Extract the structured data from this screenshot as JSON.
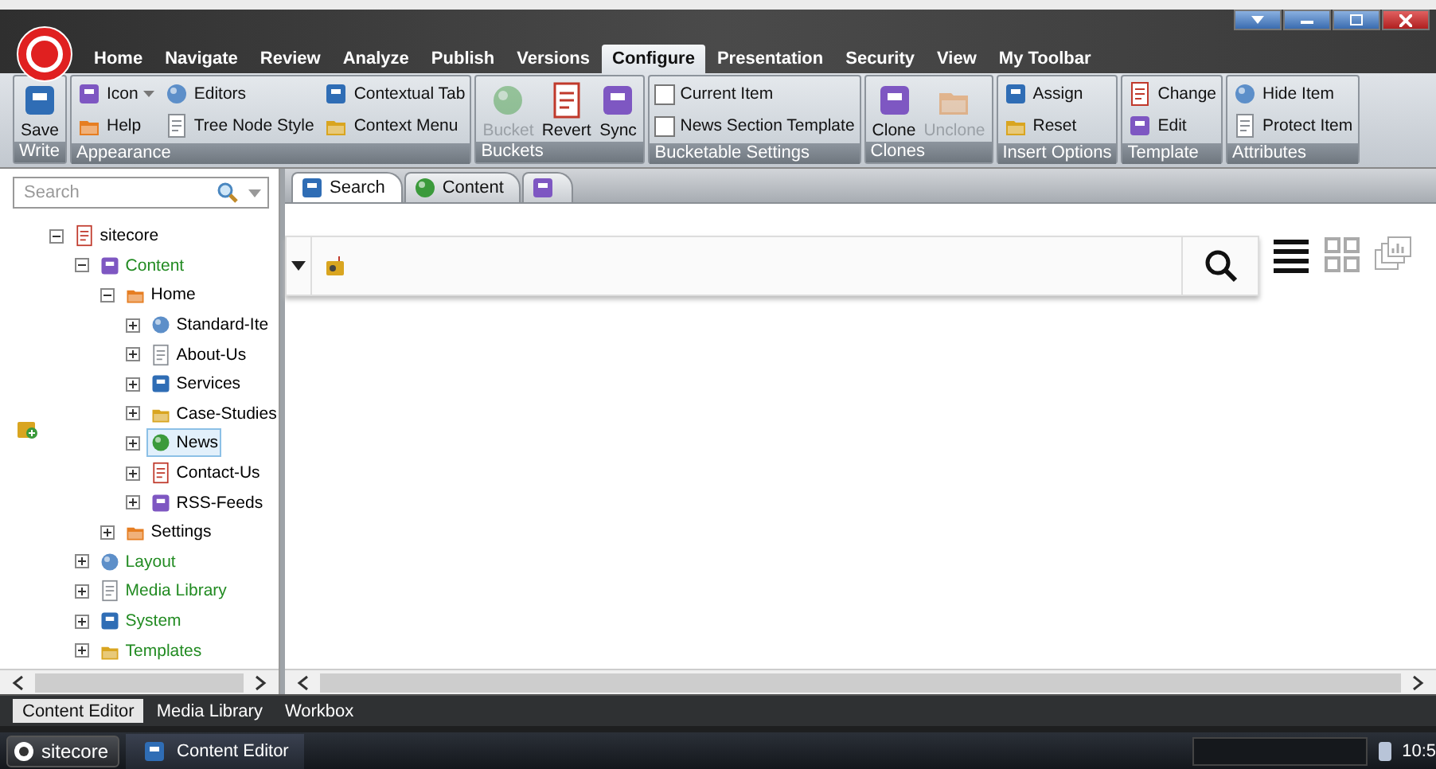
{
  "ribbon_tabs": [
    {
      "label": "Home",
      "selected": false
    },
    {
      "label": "Navigate",
      "selected": false
    },
    {
      "label": "Review",
      "selected": false
    },
    {
      "label": "Analyze",
      "selected": false
    },
    {
      "label": "Publish",
      "selected": false
    },
    {
      "label": "Versions",
      "selected": false
    },
    {
      "label": "Configure",
      "selected": true
    },
    {
      "label": "Presentation",
      "selected": false
    },
    {
      "label": "Security",
      "selected": false
    },
    {
      "label": "View",
      "selected": false
    },
    {
      "label": "My Toolbar",
      "selected": false
    }
  ],
  "ribbon_groups": [
    {
      "title": "Write",
      "items": [
        {
          "kind": "large",
          "label": "Save",
          "disabled": false
        }
      ]
    },
    {
      "title": "Appearance",
      "items": [
        {
          "kind": "small",
          "label": "Icon",
          "has_menu": true
        },
        {
          "kind": "small",
          "label": "Help"
        },
        {
          "kind": "small",
          "label": "Editors"
        },
        {
          "kind": "small",
          "label": "Tree Node Style"
        },
        {
          "kind": "small",
          "label": "Contextual Tab"
        },
        {
          "kind": "small",
          "label": "Context Menu"
        }
      ]
    },
    {
      "title": "Buckets",
      "items": [
        {
          "kind": "large",
          "label": "Bucket",
          "disabled": true
        },
        {
          "kind": "large",
          "label": "Revert",
          "disabled": false
        },
        {
          "kind": "large",
          "label": "Sync",
          "disabled": false
        }
      ]
    },
    {
      "title": "Bucketable Settings",
      "items": [
        {
          "kind": "checkbox",
          "label": "Current Item",
          "checked": false
        },
        {
          "kind": "checkbox",
          "label": "News Section Template",
          "checked": false
        }
      ]
    },
    {
      "title": "Clones",
      "items": [
        {
          "kind": "large",
          "label": "Clone",
          "disabled": false
        },
        {
          "kind": "large",
          "label": "Unclone",
          "disabled": true
        }
      ]
    },
    {
      "title": "Insert Options",
      "items": [
        {
          "kind": "small",
          "label": "Assign"
        },
        {
          "kind": "small",
          "label": "Reset"
        }
      ]
    },
    {
      "title": "Template",
      "items": [
        {
          "kind": "small",
          "label": "Change"
        },
        {
          "kind": "small",
          "label": "Edit"
        }
      ]
    },
    {
      "title": "Attributes",
      "items": [
        {
          "kind": "small",
          "label": "Hide Item"
        },
        {
          "kind": "small",
          "label": "Protect Item"
        }
      ]
    }
  ],
  "tree_search": {
    "placeholder": "Search"
  },
  "tree": [
    {
      "label": "sitecore",
      "color": "#000000",
      "expanded": true,
      "selected": false,
      "children": [
        {
          "label": "Content",
          "color": "#228b22",
          "expanded": true,
          "selected": false,
          "children": [
            {
              "label": "Home",
              "color": "#000000",
              "expanded": true,
              "selected": false,
              "children": [
                {
                  "label": "Standard-Ite",
                  "color": "#000000",
                  "expanded": false,
                  "selected": false
                },
                {
                  "label": "About-Us",
                  "color": "#000000",
                  "expanded": false,
                  "selected": false
                },
                {
                  "label": "Services",
                  "color": "#000000",
                  "expanded": false,
                  "selected": false
                },
                {
                  "label": "Case-Studies",
                  "color": "#000000",
                  "expanded": false,
                  "selected": false
                },
                {
                  "label": "News",
                  "color": "#000000",
                  "expanded": false,
                  "selected": true
                },
                {
                  "label": "Contact-Us",
                  "color": "#000000",
                  "expanded": false,
                  "selected": false
                },
                {
                  "label": "RSS-Feeds",
                  "color": "#000000",
                  "expanded": false,
                  "selected": false
                }
              ]
            },
            {
              "label": "Settings",
              "color": "#000000",
              "expanded": false,
              "selected": false
            }
          ]
        },
        {
          "label": "Layout",
          "color": "#228b22",
          "expanded": false,
          "selected": false
        },
        {
          "label": "Media Library",
          "color": "#228b22",
          "expanded": false,
          "selected": false
        },
        {
          "label": "System",
          "color": "#228b22",
          "expanded": false,
          "selected": false
        },
        {
          "label": "Templates",
          "color": "#228b22",
          "expanded": false,
          "selected": false
        }
      ]
    }
  ],
  "editor_tabs": [
    {
      "label": "Search",
      "selected": true
    },
    {
      "label": "Content",
      "selected": false
    },
    {
      "selected": false
    }
  ],
  "view_modes": [
    {
      "selected": true
    },
    {
      "selected": false
    },
    {
      "selected": false
    }
  ],
  "bottom_tabs": [
    {
      "label": "Content Editor",
      "selected": true
    },
    {
      "label": "Media Library",
      "selected": false
    },
    {
      "label": "Workbox",
      "selected": false
    }
  ],
  "taskbar": {
    "start": "sitecore",
    "tasks": [
      "Content Editor"
    ],
    "clock": "10:5"
  }
}
